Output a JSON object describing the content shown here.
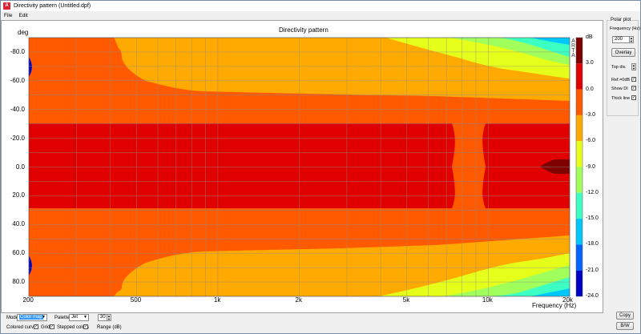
{
  "window": {
    "title": "Directivity pattern (Untitled.dpf)"
  },
  "menu": {
    "file": "File",
    "edit": "Edit"
  },
  "plot": {
    "title": "Directivity pattern",
    "y_unit": "deg",
    "x_label": "Frequency (Hz)",
    "y_ticks": [
      "-80.0",
      "-60.0",
      "-40.0",
      "-20.0",
      "0.0",
      "20.0",
      "40.0",
      "60.0",
      "80.0"
    ],
    "x_ticks": [
      "200",
      "500",
      "1k",
      "2k",
      "5k",
      "10k",
      "20k"
    ],
    "colorbar_unit": "dB",
    "colorbar_ticks": [
      "3.0",
      "0.0",
      "-3.0",
      "-6.0",
      "-9.0",
      "-12.0",
      "-15.0",
      "-18.0",
      "-21.0",
      "-24.0"
    ],
    "watermark": "ARTA"
  },
  "chart_data": {
    "type": "heatmap",
    "title": "Directivity pattern",
    "xlabel": "Frequency (Hz)",
    "ylabel": "deg",
    "x_scale": "log",
    "xlim": [
      200,
      20000
    ],
    "ylim": [
      -90,
      90
    ],
    "colorbar_label": "dB",
    "colorbar_range": [
      -24,
      6
    ],
    "levels": [
      {
        "min": 3,
        "max": 6,
        "color": "#7f0000"
      },
      {
        "min": 0,
        "max": 3,
        "color": "#e00000"
      },
      {
        "min": -3,
        "max": 0,
        "color": "#ff5a00"
      },
      {
        "min": -6,
        "max": -3,
        "color": "#ffaa00"
      },
      {
        "min": -9,
        "max": -6,
        "color": "#e6ff1a"
      },
      {
        "min": -12,
        "max": -9,
        "color": "#a0ff5a"
      },
      {
        "min": -15,
        "max": -12,
        "color": "#3cffc3"
      },
      {
        "min": -18,
        "max": -15,
        "color": "#00c8ff"
      },
      {
        "min": -21,
        "max": -18,
        "color": "#0064ff"
      },
      {
        "min": -24,
        "max": -21,
        "color": "#0000c8"
      }
    ]
  },
  "panel": {
    "group_title": "Polar plot",
    "freq_label": "Frequency (Hz)",
    "freq_value": "200",
    "overlay_label": "Overlay",
    "topdiv_label": "Top div.",
    "ref_label": "Ref.=0dB",
    "showdi_label": "Show DI",
    "thickline_label": "Thick line",
    "copy_label": "Copy",
    "bw_label": "B/W"
  },
  "bottom": {
    "mode_label": "Mode",
    "mode_value": "Color map",
    "palette_label": "Palette",
    "palette_value": "Jet",
    "range_value": "30",
    "range_label": "Range (dB)",
    "colored_curves_label": "Colored curves",
    "grid_label": "Grid",
    "stepped_label": "Stepped colors"
  }
}
